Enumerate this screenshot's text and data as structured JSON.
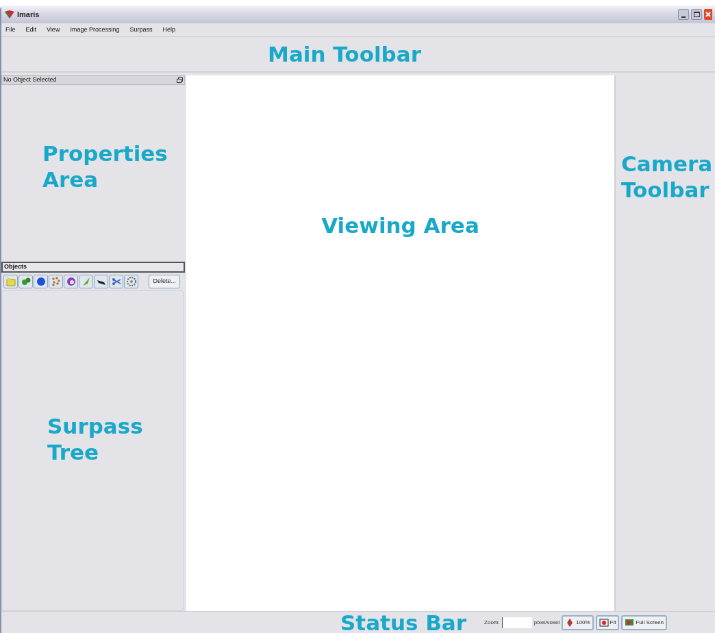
{
  "window": {
    "title": "Imaris"
  },
  "menu": [
    "File",
    "Edit",
    "View",
    "Image Processing",
    "Surpass",
    "Help"
  ],
  "main_toolbar": {
    "annotation": "Main Toolbar"
  },
  "properties": {
    "header": "No Object Selected",
    "annotation": [
      "Properties",
      "Area"
    ]
  },
  "objects": {
    "header": "Objects",
    "delete_button": "Delete..."
  },
  "surpass_tree": {
    "annotation": [
      "Surpass",
      "Tree"
    ]
  },
  "viewing_area": {
    "annotation": "Viewing Area"
  },
  "camera_toolbar": {
    "annotation": [
      "Camera",
      "Toolbar"
    ]
  },
  "status_bar": {
    "annotation": "Status Bar",
    "zoom_label": "Zoom:",
    "unit": "pixel/voxel",
    "buttons": [
      "100%",
      "Fit",
      "Full Screen"
    ]
  }
}
